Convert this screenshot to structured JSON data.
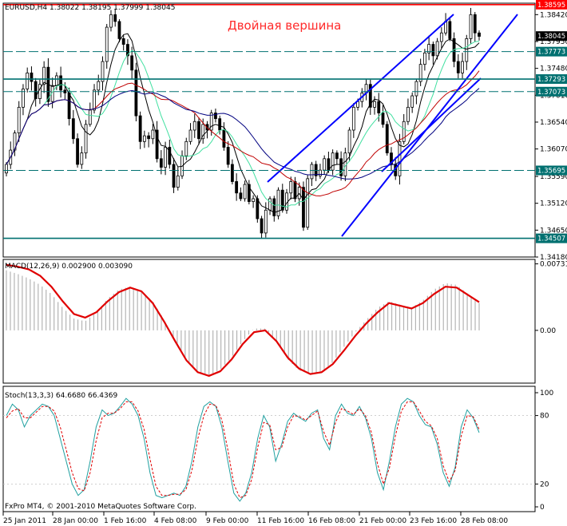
{
  "chart_data": [
    {
      "type": "candlestick",
      "symbol_label": "EURUSD,H4",
      "ohlc_label": "1.38022 1.38195 1.37999 1.38045",
      "annotation": "Двойная вершина",
      "ylim": [
        1.3418,
        1.3862
      ],
      "yticks": [
        "1.38420",
        "1.37950",
        "1.37480",
        "1.37010",
        "1.36540",
        "1.36070",
        "1.35590",
        "1.35120",
        "1.34650",
        "1.34180"
      ],
      "ytick_values": [
        1.3842,
        1.3795,
        1.3748,
        1.3701,
        1.3654,
        1.3607,
        1.3559,
        1.3512,
        1.3465,
        1.3418
      ],
      "horizontal_levels": [
        {
          "value": 1.38595,
          "label": "1.38595",
          "style": "solid",
          "color": "#ff0000"
        },
        {
          "value": 1.37773,
          "label": "1.37773",
          "style": "dashed",
          "color": "#007070"
        },
        {
          "value": 1.37293,
          "label": "1.37293",
          "style": "solid",
          "color": "#007070"
        },
        {
          "value": 1.37073,
          "label": "1.37073",
          "style": "dashed",
          "color": "#007070"
        },
        {
          "value": 1.35695,
          "label": "1.35695",
          "style": "dashed",
          "color": "#007070"
        },
        {
          "value": 1.34507,
          "label": "1.34507",
          "style": "solid",
          "color": "#007070"
        }
      ],
      "current_price": {
        "value": 1.38045,
        "label": "1.38045"
      },
      "candle_count": 114,
      "closes": [
        1.358,
        1.3605,
        1.3635,
        1.368,
        1.3712,
        1.374,
        1.3725,
        1.3695,
        1.372,
        1.375,
        1.369,
        1.3718,
        1.3735,
        1.371,
        1.3705,
        1.366,
        1.3625,
        1.358,
        1.36,
        1.365,
        1.3675,
        1.371,
        1.3725,
        1.376,
        1.382,
        1.3842,
        1.383,
        1.38,
        1.379,
        1.377,
        1.3745,
        1.3665,
        1.362,
        1.363,
        1.3625,
        1.364,
        1.359,
        1.3575,
        1.361,
        1.358,
        1.354,
        1.356,
        1.3595,
        1.362,
        1.364,
        1.3655,
        1.3625,
        1.365,
        1.364,
        1.367,
        1.366,
        1.364,
        1.361,
        1.358,
        1.355,
        1.353,
        1.352,
        1.3545,
        1.3515,
        1.352,
        1.3485,
        1.346,
        1.35,
        1.352,
        1.349,
        1.3535,
        1.35,
        1.353,
        1.355,
        1.352,
        1.354,
        1.347,
        1.3555,
        1.358,
        1.356,
        1.357,
        1.359,
        1.357,
        1.36,
        1.359,
        1.356,
        1.36,
        1.364,
        1.368,
        1.369,
        1.3705,
        1.372,
        1.368,
        1.369,
        1.367,
        1.365,
        1.36,
        1.358,
        1.356,
        1.362,
        1.3655,
        1.368,
        1.37,
        1.3725,
        1.3755,
        1.3775,
        1.379,
        1.377,
        1.3795,
        1.381,
        1.383,
        1.38,
        1.376,
        1.374,
        1.376,
        1.38,
        1.3842,
        1.381,
        1.3804
      ]
    },
    {
      "type": "line",
      "title": "MACD(12,26,9) 0.002900 0.003090",
      "ylim": [
        -0.0058,
        0.0078
      ],
      "yticks": [
        "0.00731",
        "0.00"
      ],
      "ytick_values": [
        0.00731,
        0.0
      ],
      "series": [
        {
          "name": "MACD histogram",
          "kind": "histogram",
          "color": "#b4b4b4",
          "values": [
            0.0066,
            0.0062,
            0.0057,
            0.005,
            0.004,
            0.0025,
            0.0013,
            0.001,
            0.002,
            0.0035,
            0.0045,
            0.0048,
            0.0043,
            0.0032,
            0.0012,
            -0.0012,
            -0.0032,
            -0.0045,
            -0.005,
            -0.0043,
            -0.003,
            -0.0012,
            0.0002,
            0.0002,
            -0.0012,
            -0.0032,
            -0.0044,
            -0.0048,
            -0.0046,
            -0.0035,
            -0.0018,
            -0.0002,
            0.0012,
            0.0025,
            0.0032,
            0.0028,
            0.0025,
            0.0033,
            0.0045,
            0.0052,
            0.005,
            0.004,
            0.003
          ]
        },
        {
          "name": "MACD signal",
          "kind": "line",
          "color": "#e00000",
          "values": [
            0.0072,
            0.007,
            0.0067,
            0.006,
            0.0048,
            0.0032,
            0.0018,
            0.0014,
            0.002,
            0.0032,
            0.0042,
            0.0047,
            0.0043,
            0.003,
            0.001,
            -0.0012,
            -0.0033,
            -0.0046,
            -0.005,
            -0.0045,
            -0.0032,
            -0.0015,
            -0.0002,
            0.0,
            -0.0012,
            -0.003,
            -0.0042,
            -0.0048,
            -0.0046,
            -0.0037,
            -0.0022,
            -0.0006,
            0.0008,
            0.002,
            0.003,
            0.0027,
            0.0024,
            0.003,
            0.004,
            0.0048,
            0.0047,
            0.0039,
            0.0031
          ]
        }
      ]
    },
    {
      "type": "line",
      "title": "Stoch(13,3,3) 64.6680 66.4369",
      "ylim": [
        0,
        100
      ],
      "yticks": [
        "100",
        "80",
        "20",
        "0"
      ],
      "ytick_values": [
        100,
        80,
        20,
        0
      ],
      "series": [
        {
          "name": "main",
          "color": "#20a0a0",
          "values": [
            80,
            90,
            85,
            70,
            80,
            85,
            90,
            88,
            80,
            60,
            40,
            20,
            10,
            15,
            40,
            70,
            85,
            80,
            82,
            88,
            95,
            90,
            80,
            60,
            30,
            10,
            8,
            10,
            12,
            10,
            18,
            40,
            70,
            88,
            92,
            88,
            70,
            40,
            12,
            5,
            12,
            30,
            60,
            80,
            70,
            40,
            55,
            75,
            82,
            78,
            75,
            82,
            85,
            60,
            50,
            80,
            90,
            82,
            80,
            88,
            78,
            60,
            30,
            15,
            40,
            70,
            90,
            95,
            92,
            80,
            72,
            70,
            55,
            30,
            18,
            35,
            70,
            85,
            78,
            65
          ]
        },
        {
          "name": "signal",
          "color": "#e00000",
          "values": [
            78,
            84,
            86,
            78,
            78,
            83,
            88,
            88,
            84,
            70,
            50,
            30,
            16,
            14,
            30,
            58,
            78,
            82,
            82,
            86,
            92,
            92,
            84,
            68,
            42,
            18,
            10,
            10,
            11,
            11,
            15,
            32,
            60,
            80,
            90,
            89,
            76,
            50,
            20,
            8,
            10,
            24,
            52,
            74,
            72,
            50,
            52,
            70,
            80,
            79,
            76,
            80,
            84,
            66,
            54,
            74,
            86,
            84,
            81,
            86,
            80,
            65,
            38,
            20,
            34,
            62,
            84,
            92,
            92,
            84,
            75,
            71,
            60,
            36,
            22,
            32,
            62,
            80,
            79,
            68
          ]
        }
      ]
    }
  ],
  "time_axis": [
    "25 Jan 2011",
    "28 Jan 00:00",
    "1 Feb 16:00",
    "4 Feb 08:00",
    "9 Feb 00:00",
    "11 Feb 16:00",
    "16 Feb 08:00",
    "21 Feb 00:00",
    "23 Feb 16:00",
    "28 Feb 08:00"
  ],
  "copyright": "FxPro MT4, © 2001-2010 MetaQuotes Software Corp.",
  "colors": {
    "bull": "#000000",
    "bear": "#000000",
    "ma_fast": "#40e0a0",
    "ma_slow": "#000000",
    "ma_red": "#c00000",
    "ma_blue": "#000080",
    "trendline": "#0000ff"
  }
}
